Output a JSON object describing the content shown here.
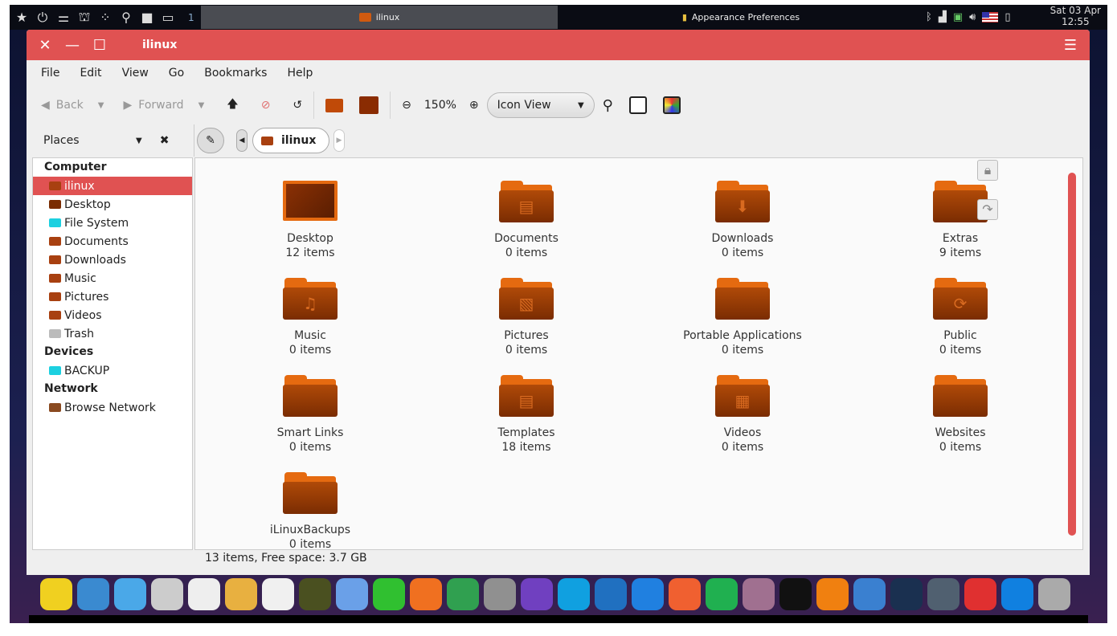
{
  "panel": {
    "workspace": "1",
    "tasks": [
      {
        "label": "ilinux"
      },
      {
        "label": "Appearance Preferences"
      }
    ],
    "clock_date": "Sat 03 Apr",
    "clock_time": "12:55",
    "launchers": [
      "star-icon",
      "power-icon",
      "toggle-icon",
      "binoculars-icon",
      "apps-icon",
      "search-icon",
      "folder-icon",
      "window-icon"
    ],
    "tray": [
      "bluetooth-icon",
      "signal-icon",
      "battery-icon",
      "volume-icon",
      "us-flag-icon",
      "clipboard-icon"
    ]
  },
  "window": {
    "title": "ilinux",
    "accent": "#e05252"
  },
  "menu": [
    "File",
    "Edit",
    "View",
    "Go",
    "Bookmarks",
    "Help"
  ],
  "toolbar": {
    "back": "Back",
    "forward": "Forward",
    "zoom": "150%",
    "view": "Icon View"
  },
  "places": {
    "label": "Places",
    "path": "ilinux"
  },
  "sidebar": [
    {
      "header": "Computer",
      "items": [
        {
          "label": "ilinux",
          "selected": true
        },
        {
          "label": "Desktop"
        },
        {
          "label": "File System"
        },
        {
          "label": "Documents"
        },
        {
          "label": "Downloads"
        },
        {
          "label": "Music"
        },
        {
          "label": "Pictures"
        },
        {
          "label": "Videos"
        },
        {
          "label": "Trash"
        }
      ]
    },
    {
      "header": "Devices",
      "items": [
        {
          "label": "BACKUP"
        }
      ]
    },
    {
      "header": "Network",
      "items": [
        {
          "label": "Browse Network"
        }
      ]
    }
  ],
  "files": [
    {
      "name": "Desktop",
      "count": "12 items",
      "glyph": ""
    },
    {
      "name": "Documents",
      "count": "0 items",
      "glyph": "▤"
    },
    {
      "name": "Downloads",
      "count": "0 items",
      "glyph": "⬇"
    },
    {
      "name": "Extras",
      "count": "9 items",
      "glyph": ""
    },
    {
      "name": "Music",
      "count": "0 items",
      "glyph": "♫"
    },
    {
      "name": "Pictures",
      "count": "0 items",
      "glyph": "▧"
    },
    {
      "name": "Portable Applications",
      "count": "0 items",
      "glyph": ""
    },
    {
      "name": "Public",
      "count": "0 items",
      "glyph": "⟳"
    },
    {
      "name": "Smart Links",
      "count": "0 items",
      "glyph": ""
    },
    {
      "name": "Templates",
      "count": "18 items",
      "glyph": "▤"
    },
    {
      "name": "Videos",
      "count": "0 items",
      "glyph": "▦"
    },
    {
      "name": "Websites",
      "count": "0 items",
      "glyph": ""
    },
    {
      "name": "iLinuxBackups",
      "count": "0 items",
      "glyph": ""
    }
  ],
  "status": "13 items, Free space: 3.7 GB",
  "dock": [
    {
      "name": "star",
      "color": "#f0d020"
    },
    {
      "name": "dots",
      "color": "#3a8ad0"
    },
    {
      "name": "files",
      "color": "#4aa8e8"
    },
    {
      "name": "cabinet",
      "color": "#ccc"
    },
    {
      "name": "toggles",
      "color": "#eee"
    },
    {
      "name": "palette",
      "color": "#e8b040"
    },
    {
      "name": "store",
      "color": "#f0f0f0"
    },
    {
      "name": "binoculars",
      "color": "#4a5020"
    },
    {
      "name": "rocket",
      "color": "#6aa0e8"
    },
    {
      "name": "pipe",
      "color": "#30c030"
    },
    {
      "name": "firefox",
      "color": "#f07020"
    },
    {
      "name": "chrome",
      "color": "#30a050"
    },
    {
      "name": "earth-pro",
      "color": "#909090"
    },
    {
      "name": "viber",
      "color": "#7040c0"
    },
    {
      "name": "skype",
      "color": "#10a0e0"
    },
    {
      "name": "mail",
      "color": "#2070c0"
    },
    {
      "name": "writer",
      "color": "#2080e0"
    },
    {
      "name": "presentation",
      "color": "#f06030"
    },
    {
      "name": "spreadsheet",
      "color": "#20b050"
    },
    {
      "name": "screenshot",
      "color": "#a07090"
    },
    {
      "name": "amazon",
      "color": "#111"
    },
    {
      "name": "vlc",
      "color": "#f08010"
    },
    {
      "name": "qbittorrent",
      "color": "#3a80d0"
    },
    {
      "name": "steam",
      "color": "#1a3050"
    },
    {
      "name": "backup",
      "color": "#506070"
    },
    {
      "name": "anydesk",
      "color": "#e03030"
    },
    {
      "name": "teamviewer",
      "color": "#1080e0"
    },
    {
      "name": "trash",
      "color": "#aaa"
    }
  ]
}
